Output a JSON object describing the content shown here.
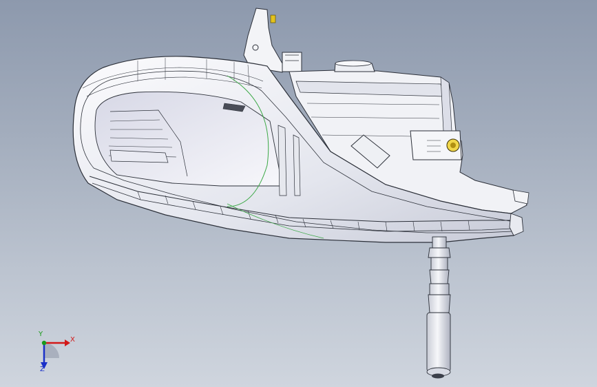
{
  "viewport": {
    "background_top": "#8d99ad",
    "background_bottom": "#cfd5de"
  },
  "model": {
    "subject": "headlamp-assembly",
    "line_color": "#2b2f38",
    "fill_color": "#f4f5f8",
    "shade_color": "#c9ccd8",
    "accent_green": "#3aa845",
    "bolt_color": "#e3c21c"
  },
  "triad": {
    "x_label": "X",
    "y_label": "Y",
    "z_label": "Z",
    "x_color": "#d21818",
    "y_color": "#1a9a1a",
    "z_color": "#1a30c8"
  }
}
